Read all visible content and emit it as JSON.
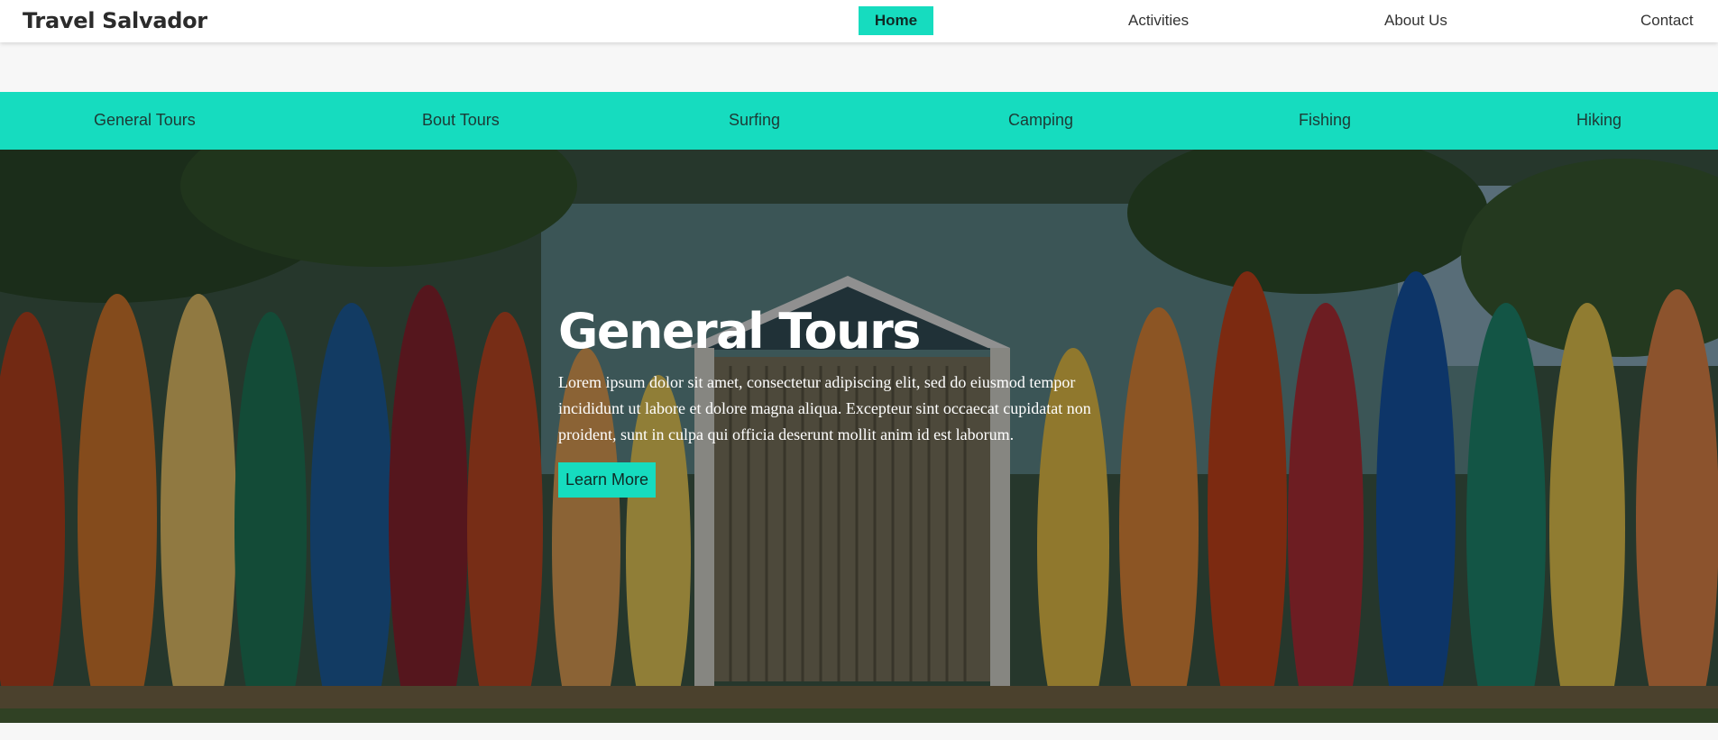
{
  "brand": "Travel Salvador",
  "nav": {
    "home": "Home",
    "activities": "Activities",
    "about": "About Us",
    "contact": "Contact"
  },
  "categories": [
    "General Tours",
    "Bout Tours",
    "Surfing",
    "Camping",
    "Fishing",
    "Hiking"
  ],
  "hero": {
    "title": "General Tours",
    "text": "Lorem ipsum dolor sit amet, consectetur adipiscing elit, sed do eiusmod tempor incididunt ut labore et dolore magna aliqua. Excepteur sint occaecat cupidatat non proident, sunt in culpa qui officia deserunt mollit anim id est laborum.",
    "button": "Learn More",
    "image": "surfboards-fence-photo"
  },
  "colors": {
    "accent": "#16dcbf",
    "brand_text": "#2b2b2b"
  }
}
